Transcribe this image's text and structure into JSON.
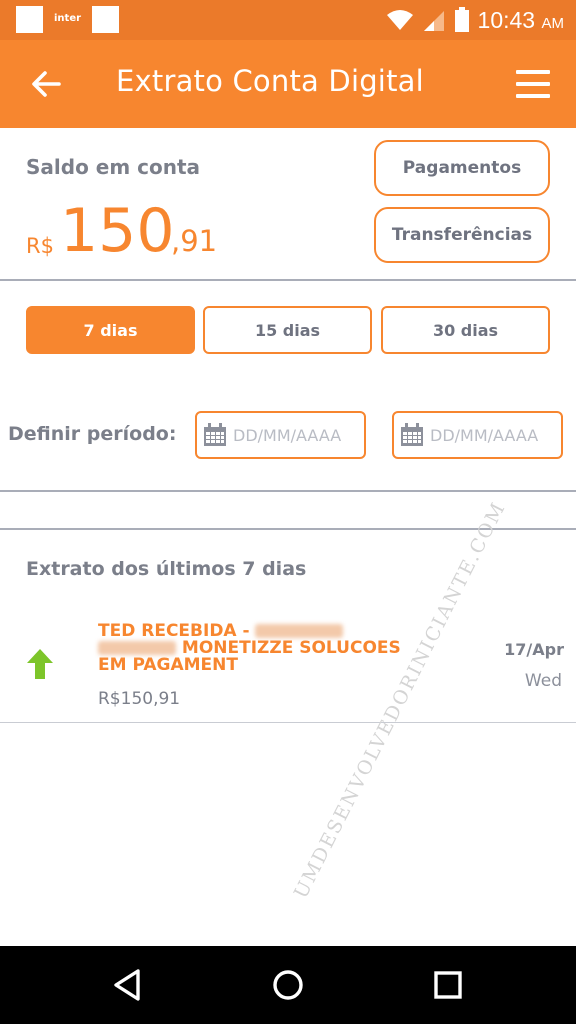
{
  "status_bar": {
    "carrier_label": "inter",
    "time": "10:43",
    "ampm": "AM"
  },
  "app_bar": {
    "title": "Extrato Conta Digital",
    "back_icon": "arrow-left-icon",
    "menu_icon": "hamburger-menu-icon"
  },
  "balance": {
    "label": "Saldo em conta",
    "currency": "R$",
    "integer": "150",
    "decimal": ",91"
  },
  "actions": {
    "payments": "Pagamentos",
    "transfers": "Transferências"
  },
  "period_tabs": [
    {
      "label": "7 dias",
      "active": true
    },
    {
      "label": "15 dias",
      "active": false
    },
    {
      "label": "30 dias",
      "active": false
    }
  ],
  "custom_period": {
    "label": "Definir período:",
    "start_placeholder": "DD/MM/AAAA",
    "end_placeholder": "DD/MM/AAAA"
  },
  "statement": {
    "title": "Extrato dos últimos 7 dias",
    "transactions": [
      {
        "title_prefix": "TED RECEBIDA -",
        "title_rest": "MONETIZZE SOLUCOES",
        "title_line3": "EM PAGAMENT",
        "amount": "R$150,91",
        "date": "17/Apr",
        "weekday": "Wed",
        "direction": "incoming"
      }
    ]
  },
  "watermark": "UMDESENVOLVEDORINICIANTE.COM",
  "colors": {
    "accent": "#f7862f",
    "status_bar": "#eb7a2a",
    "incoming_arrow": "#7dc52a",
    "text_gray": "#7b7f8a"
  }
}
